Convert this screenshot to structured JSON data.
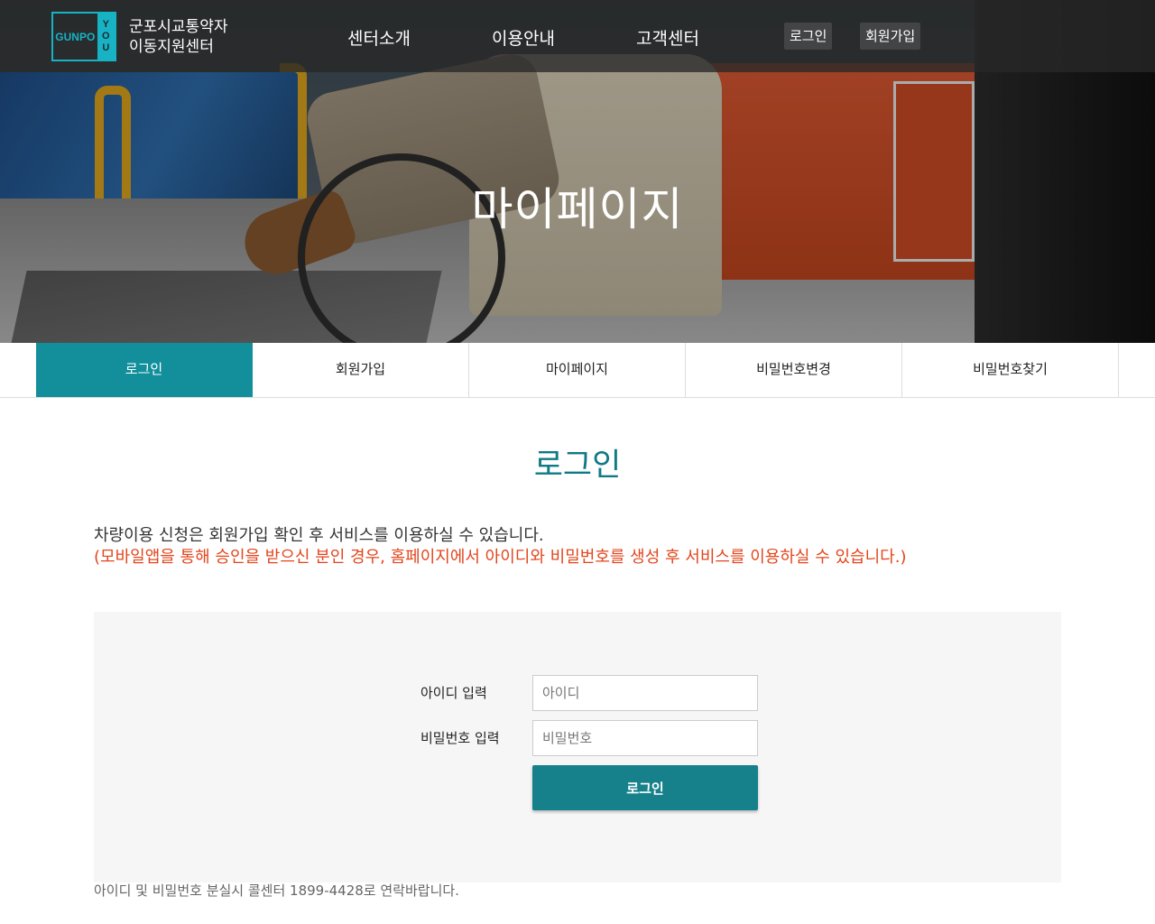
{
  "header": {
    "logo": {
      "text_left": "GUNPO",
      "text_right": [
        "Y",
        "O",
        "U"
      ]
    },
    "site_name_line1": "군포시교통약자",
    "site_name_line2": "이동지원센터",
    "nav": [
      "센터소개",
      "이용안내",
      "고객센터"
    ],
    "util": {
      "login": "로그인",
      "signup": "회원가입"
    }
  },
  "hero": {
    "title": "마이페이지"
  },
  "tabs": [
    {
      "label": "로그인",
      "active": true
    },
    {
      "label": "회원가입",
      "active": false
    },
    {
      "label": "마이페이지",
      "active": false
    },
    {
      "label": "비밀번호변경",
      "active": false
    },
    {
      "label": "비밀번호찾기",
      "active": false
    }
  ],
  "content": {
    "title": "로그인",
    "notice_line1": "차량이용 신청은 회원가입 확인 후 서비스를 이용하실 수 있습니다.",
    "notice_line2": "(모바일앱을 통해 승인을 받으신 분인 경우, 홈페이지에서 아이디와 비밀번호를 생성 후 서비스를 이용하실 수 있습니다.)"
  },
  "form": {
    "id_label": "아이디 입력",
    "id_placeholder": "아이디",
    "id_value": "",
    "pw_label": "비밀번호 입력",
    "pw_placeholder": "비밀번호",
    "pw_value": "",
    "submit_label": "로그인"
  },
  "footer_note": "아이디 및 비밀번호 분실시 콜센터 1899-4428로 연락바랍니다.",
  "colors": {
    "accent": "#138f9c",
    "button": "#17818b",
    "title": "#0f7a84",
    "warning": "#e2451c",
    "logo": "#17b3c4"
  },
  "icons": [
    "logo"
  ]
}
